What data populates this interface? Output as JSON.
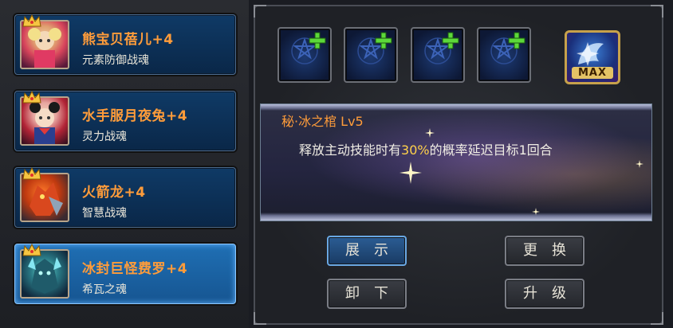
{
  "roster": [
    {
      "name": "熊宝贝蓓儿+4",
      "type": "元素防御战魂",
      "selected": false
    },
    {
      "name": "水手服月夜兔+4",
      "type": "灵力战魂",
      "selected": false
    },
    {
      "name": "火箭龙+4",
      "type": "智慧战魂",
      "selected": false
    },
    {
      "name": "冰封巨怪费罗+4",
      "type": "希瓦之魂",
      "selected": true
    }
  ],
  "max_badge": "MAX",
  "skill": {
    "title": "秘·冰之棺 Lv5",
    "desc_before": "释放主动技能时有",
    "desc_highlight": "30%",
    "desc_after": "的概率延迟目标1回合"
  },
  "buttons": {
    "show": "展示",
    "replace": "更换",
    "unequip": "卸下",
    "upgrade": "升级"
  },
  "colors": {
    "name_orange": "#ff9c3a",
    "highlight_yellow": "#ffd24a",
    "selected_blue": "#1f6fb4",
    "max_gold": "#c7a14b"
  }
}
